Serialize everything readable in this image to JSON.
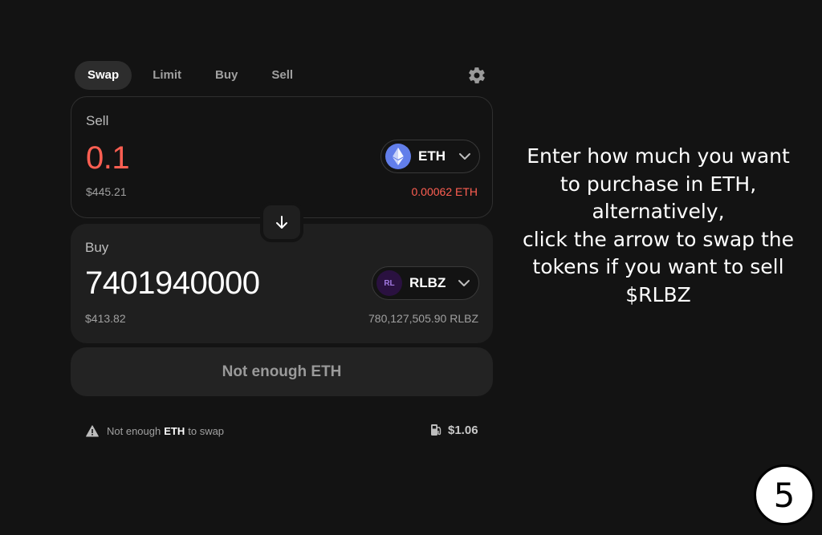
{
  "tabs": [
    {
      "label": "Swap",
      "active": true
    },
    {
      "label": "Limit",
      "active": false
    },
    {
      "label": "Buy",
      "active": false
    },
    {
      "label": "Sell",
      "active": false
    }
  ],
  "settings_icon": "gear-icon",
  "sell": {
    "label": "Sell",
    "amount": "0.1",
    "token": "ETH",
    "token_icon": "ethereum-icon",
    "usd_value": "$445.21",
    "balance": "0.00062 ETH"
  },
  "swap_direction_icon": "arrow-down-icon",
  "buy": {
    "label": "Buy",
    "amount": "7401940000",
    "token": "RLBZ",
    "token_icon_text": "RL",
    "usd_value": "$413.82",
    "balance": "780,127,505.90 RLBZ"
  },
  "action_button": "Not enough ETH",
  "warning": {
    "prefix": "Not enough",
    "token": "ETH",
    "suffix": "to swap",
    "icon": "warning-icon"
  },
  "fee": {
    "value": "$1.06",
    "icon": "gas-pump-icon"
  },
  "instruction_lines": [
    "Enter how much you want",
    "to purchase in ETH,",
    "alternatively,",
    "click the arrow to swap the",
    "tokens if you want to sell",
    "$RLBZ"
  ],
  "step_number": "5",
  "colors": {
    "background": "#131313",
    "negative": "#ff5f52",
    "eth_brand": "#627eea",
    "panel": "#1f1f1f"
  }
}
